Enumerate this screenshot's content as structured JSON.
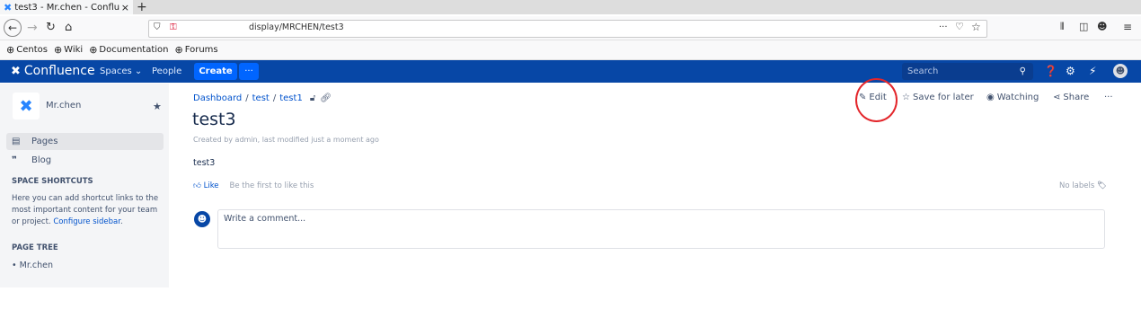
{
  "browser": {
    "tab_title": "test3 - Mr.chen - Conflu",
    "tab_close": "×",
    "new_tab": "+",
    "url": "display/MRCHEN/test3",
    "url_more": "···",
    "bookmarks": [
      "Centos",
      "Wiki",
      "Documentation",
      "Forums"
    ]
  },
  "header": {
    "product": "Confluence",
    "spaces_label": "Spaces ⌄",
    "people_label": "People",
    "create_label": "Create",
    "more_label": "···",
    "search_placeholder": "Search"
  },
  "sidebar": {
    "space_name": "Mr.chen",
    "pages_label": "Pages",
    "blog_label": "Blog",
    "shortcuts_heading": "SPACE SHORTCUTS",
    "shortcuts_text": "Here you can add shortcut links to the most important content for your team or project.",
    "configure_link": "Configure sidebar",
    "shortcuts_end": ".",
    "page_tree_heading": "PAGE TREE",
    "tree_item": "Mr.chen"
  },
  "breadcrumb": [
    "Dashboard",
    "test",
    "test1"
  ],
  "page": {
    "title": "test3",
    "byline": "Created by admin, last modified just a moment ago",
    "body": "test3",
    "like_label": "Like",
    "like_prompt": "Be the first to like this",
    "no_labels": "No labels",
    "comment_placeholder": "Write a comment..."
  },
  "actions": {
    "edit": "Edit",
    "save_for_later": "Save for later",
    "watching": "Watching",
    "share": "Share",
    "more": "···"
  }
}
